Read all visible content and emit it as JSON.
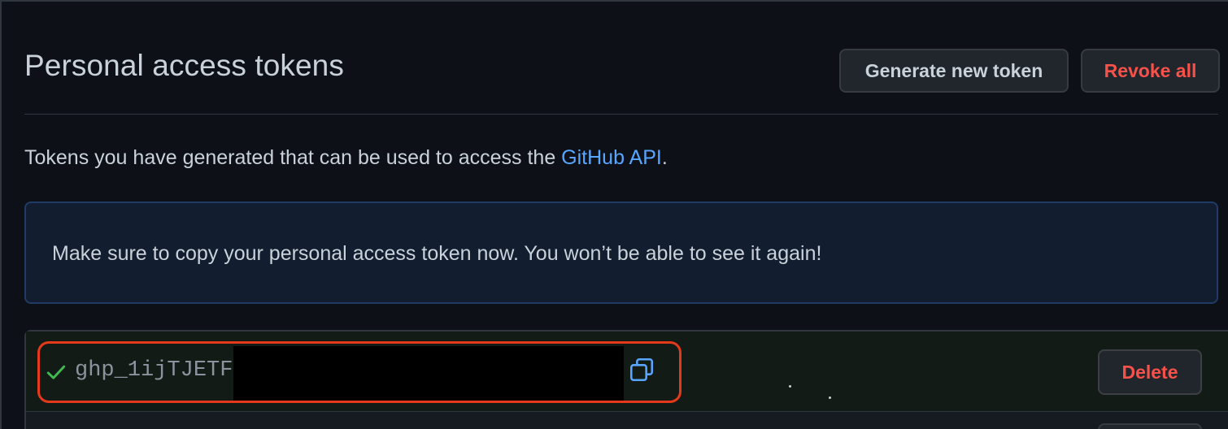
{
  "header": {
    "title": "Personal access tokens",
    "generate_label": "Generate new token",
    "revoke_label": "Revoke all"
  },
  "description": {
    "prefix": "Tokens you have generated that can be used to access the ",
    "link": "GitHub API",
    "suffix": "."
  },
  "flash": {
    "message": "Make sure to copy your personal access token now. You won’t be able to see it again!"
  },
  "token": {
    "value": "ghp_1ijTJETF",
    "status_icon": "check-icon",
    "copy_icon": "copy-icon",
    "delete_label": "Delete"
  },
  "colors": {
    "background": "#0d1117",
    "text": "#c9d1d9",
    "link": "#58a6ff",
    "danger": "#f85149",
    "success": "#3fb950",
    "highlight": "#e5391b"
  }
}
